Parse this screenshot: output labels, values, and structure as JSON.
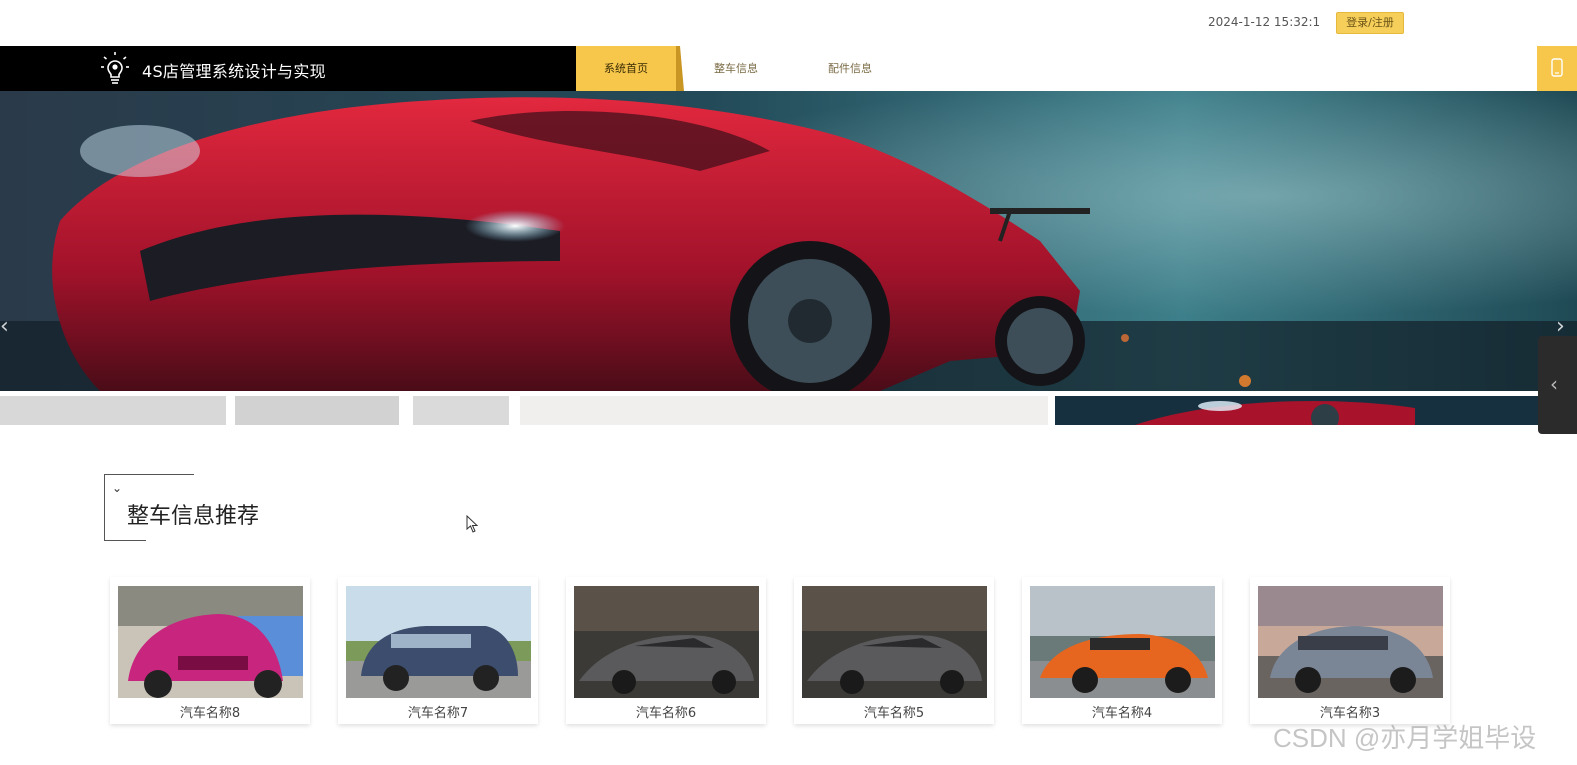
{
  "header": {
    "datetime": "2024-1-12 15:32:1",
    "login_label": "登录/注册"
  },
  "nav": {
    "brand": "4S店管理系统设计与实现",
    "logo_icon": "lightbulb-gear-icon",
    "items": [
      {
        "label": "系统首页",
        "active": true
      },
      {
        "label": "整车信息",
        "active": false
      },
      {
        "label": "配件信息",
        "active": false
      }
    ],
    "right_icon": "mobile-icon"
  },
  "banner": {
    "prev_icon": "chevron-left-icon",
    "next_icon": "chevron-right-icon",
    "thumbnail_count": 5,
    "active_thumbnail": 5
  },
  "side_tab": {
    "icon": "chevron-left-icon"
  },
  "section": {
    "title": "整车信息推荐",
    "icon": "chevron-down-icon"
  },
  "products": [
    {
      "name": "汽车名称8",
      "color": "#c8267e"
    },
    {
      "name": "汽车名称7",
      "color": "#3d4d6e"
    },
    {
      "name": "汽车名称6",
      "color": "#5a5a5c"
    },
    {
      "name": "汽车名称5",
      "color": "#5a5a5c"
    },
    {
      "name": "汽车名称4",
      "color": "#e6661f"
    },
    {
      "name": "汽车名称3",
      "color": "#7a8596"
    }
  ],
  "watermark": "CSDN @亦月学姐毕设",
  "colors": {
    "accent": "#f7c74c",
    "navbar": "#000000"
  }
}
